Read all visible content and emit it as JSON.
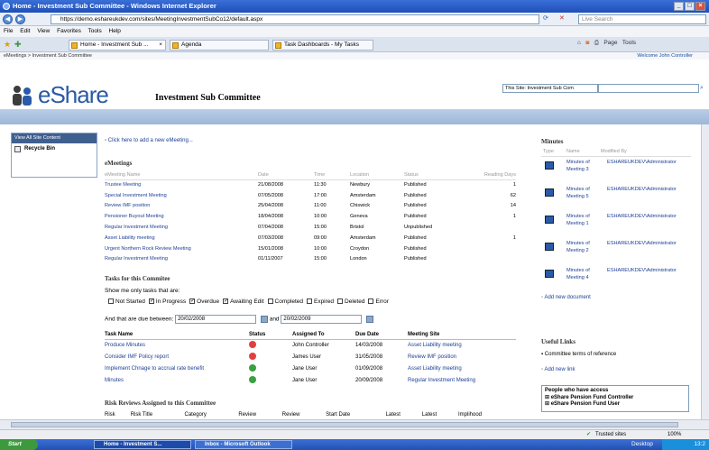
{
  "window": {
    "title": "Home - Investment Sub Committee - Windows Internet Explorer"
  },
  "address": {
    "url": "https://demo.eshareukdev.com/sites/MeetingInvestmentSubCo12/default.aspx",
    "search_placeholder": "Live Search"
  },
  "menu": [
    "File",
    "Edit",
    "View",
    "Favorites",
    "Tools",
    "Help"
  ],
  "tabs": [
    "Home - Investment Sub ...",
    "Agenda",
    "Task Dashboards - My Tasks"
  ],
  "toolbar_right": {
    "page": "Page",
    "tools": "Tools"
  },
  "breadcrumb": "eMeetings > Investment Sub Committee",
  "welcome": "Welcome John Controller",
  "header": {
    "logo": "eShare",
    "site_title": "Investment Sub Committee",
    "search_scope": "This Site: Investment Sub Com"
  },
  "leftnav": {
    "view_all": "View All Site Content",
    "recycle": "Recycle Bin"
  },
  "main": {
    "add_meeting": "Click here to add a new eMeeting...",
    "emeetings_title": "eMeetings",
    "meeting_headers": [
      "eMeeting Name",
      "Date",
      "Time",
      "Location",
      "Status",
      "Reading Days"
    ],
    "meetings": [
      {
        "name": "Trustee Meeting",
        "date": "21/08/2008",
        "time": "11:30",
        "location": "Newbury",
        "status": "Published",
        "days": "1"
      },
      {
        "name": "Special Investment Meeting",
        "date": "07/05/2008",
        "time": "17:00",
        "location": "Amsterdam",
        "status": "Published",
        "days": "62"
      },
      {
        "name": "Review IMF position",
        "date": "25/04/2008",
        "time": "11:00",
        "location": "Chiswick",
        "status": "Published",
        "days": "14"
      },
      {
        "name": "Pensioner Buyout Meeting",
        "date": "18/04/2008",
        "time": "10:00",
        "location": "Geneva",
        "status": "Published",
        "days": "1"
      },
      {
        "name": "Regular Investment Meeting",
        "date": "07/04/2008",
        "time": "15:00",
        "location": "Bristol",
        "status": "Unpublished",
        "days": ""
      },
      {
        "name": "Asset Liability meeting",
        "date": "07/03/2008",
        "time": "09:00",
        "location": "Amsterdam",
        "status": "Published",
        "days": "1"
      },
      {
        "name": "Urgent Northern Rock Review Meeting",
        "date": "15/01/2008",
        "time": "10:00",
        "location": "Croydon",
        "status": "Published",
        "days": ""
      },
      {
        "name": "Regular Investment Meeting",
        "date": "01/11/2007",
        "time": "15:00",
        "location": "London",
        "status": "Published",
        "days": ""
      }
    ],
    "tasks_title": "Tasks for this Commitee",
    "show_label": "Show me only tasks that are:",
    "filters": [
      {
        "label": "Not Started",
        "checked": false
      },
      {
        "label": "In Progress",
        "checked": true
      },
      {
        "label": "Overdue",
        "checked": true
      },
      {
        "label": "Awaiting Edit",
        "checked": true
      },
      {
        "label": "Completed",
        "checked": false
      },
      {
        "label": "Expired",
        "checked": false
      },
      {
        "label": "Deleted",
        "checked": false
      },
      {
        "label": "Error",
        "checked": false
      }
    ],
    "due_label": "And that are due between:",
    "due_from": "20/02/2008",
    "and_label": "and",
    "due_to": "20/02/2009",
    "task_headers": [
      "Task Name",
      "Status",
      "Assigned To",
      "Due Date",
      "Meeting Site"
    ],
    "tasks": [
      {
        "name": "Produce Minutes",
        "status_color": "#e04040",
        "assigned": "John Controller",
        "due": "14/03/2008",
        "site": "Asset Liability meeting"
      },
      {
        "name": "Consider IMF Policy report",
        "status_color": "#e04040",
        "assigned": "James User",
        "due": "31/05/2008",
        "site": "Review IMF position"
      },
      {
        "name": "Implement Chnage to accrual rate benefit",
        "status_color": "#3aa040",
        "assigned": "Jane User",
        "due": "01/09/2008",
        "site": "Asset Liability meeting"
      },
      {
        "name": "Minutes",
        "status_color": "#3aa040",
        "assigned": "Jane User",
        "due": "20/09/2008",
        "site": "Regular Investment Meeting"
      }
    ],
    "risk_title": "Risk Reviews Assigned to this Committee",
    "risk_headers": [
      "Risk",
      "Risk Title",
      "Category",
      "Review",
      "Review",
      "Start Date",
      "Latest",
      "Latest",
      "Implihood"
    ]
  },
  "right": {
    "minutes_title": "Minutes",
    "minutes_headers": [
      "Type",
      "Name",
      "Modified By"
    ],
    "docs": [
      {
        "name": "Minutes of Meeting 3",
        "by": "ESHAREUKDEV\\Administrator"
      },
      {
        "name": "Minutes of Meeting 5",
        "by": "ESHAREUKDEV\\Administrator"
      },
      {
        "name": "Minutes of Meeting 1",
        "by": "ESHAREUKDEV\\Administrator"
      },
      {
        "name": "Minutes of Meeting 2",
        "by": "ESHAREUKDEV\\Administrator"
      },
      {
        "name": "Minutes of Meeting 4",
        "by": "ESHAREUKDEV\\Administrator"
      }
    ],
    "add_doc": "Add new document",
    "links_title": "Useful Links",
    "link1": "Committee terms of reference",
    "add_link": "Add new link",
    "access_title": "People who have access",
    "access": [
      "eShare Pension Fund Controller",
      "eShare Pension Fund User"
    ]
  },
  "status": {
    "zone": "Trusted sites",
    "zoom": "100%"
  },
  "taskbar": {
    "start": "Start",
    "items": [
      "Home - Investment S...",
      "Inbox - Microsoft Outlook"
    ],
    "desktop": "Desktop",
    "clock": "13:2"
  }
}
